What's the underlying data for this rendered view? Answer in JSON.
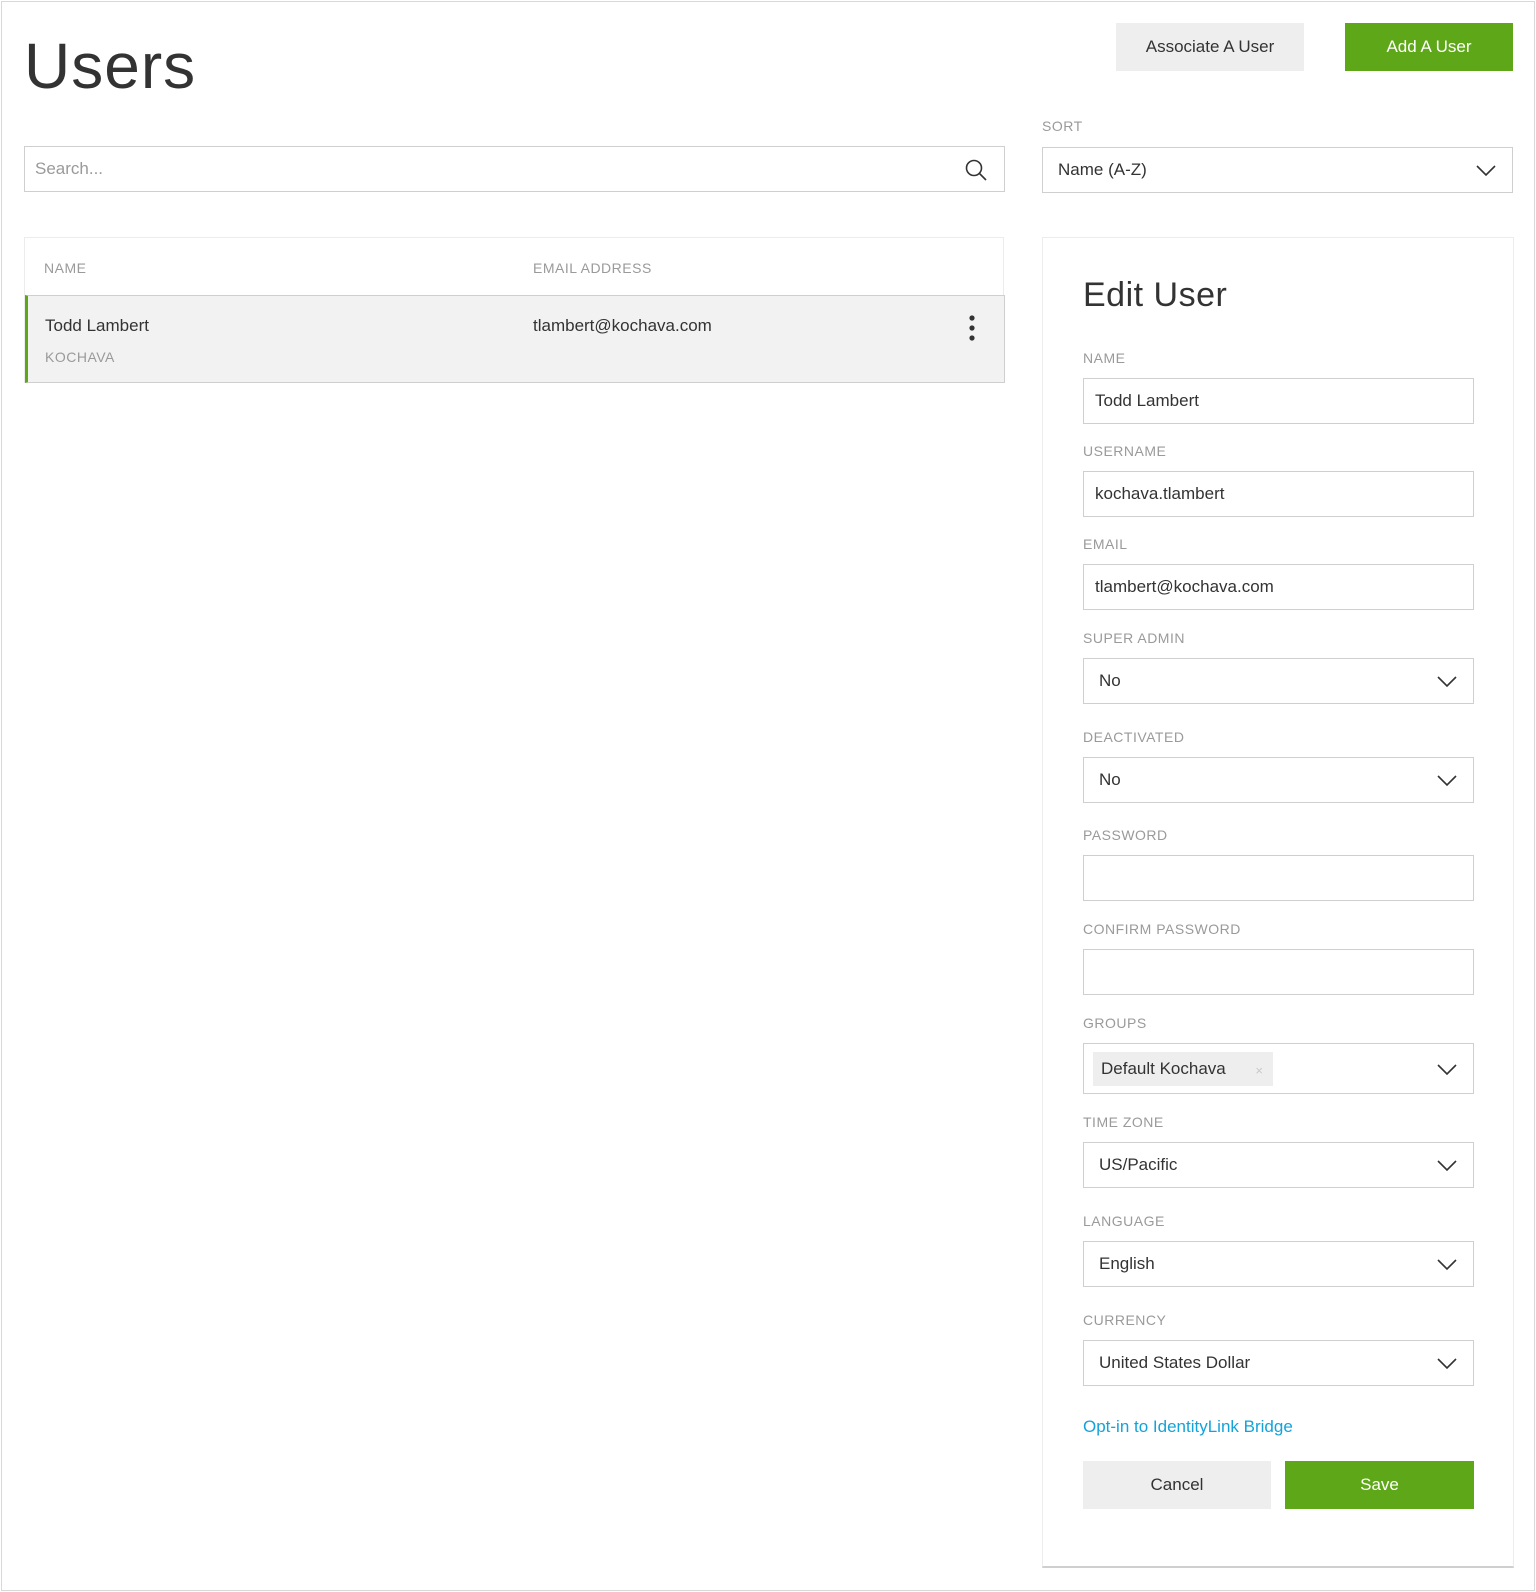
{
  "page": {
    "title": "Users"
  },
  "header": {
    "associate_label": "Associate A User",
    "add_label": "Add A User"
  },
  "search": {
    "placeholder": "Search..."
  },
  "sort": {
    "label": "SORT",
    "value": "Name (A-Z)"
  },
  "table": {
    "columns": [
      "NAME",
      "EMAIL ADDRESS"
    ],
    "rows": [
      {
        "name": "Todd Lambert",
        "org": "KOCHAVA",
        "email": "tlambert@kochava.com"
      }
    ]
  },
  "edit": {
    "title": "Edit User",
    "name": {
      "label": "NAME",
      "value": "Todd Lambert"
    },
    "username": {
      "label": "USERNAME",
      "value": "kochava.tlambert"
    },
    "email": {
      "label": "EMAIL",
      "value": "tlambert@kochava.com"
    },
    "super_admin": {
      "label": "SUPER ADMIN",
      "value": "No"
    },
    "deactivated": {
      "label": "DEACTIVATED",
      "value": "No"
    },
    "password": {
      "label": "PASSWORD",
      "value": ""
    },
    "confirm_password": {
      "label": "CONFIRM PASSWORD",
      "value": ""
    },
    "groups": {
      "label": "GROUPS",
      "tags": [
        "Default Kochava"
      ],
      "remove_glyph": "×"
    },
    "time_zone": {
      "label": "TIME ZONE",
      "value": "US/Pacific"
    },
    "language": {
      "label": "LANGUAGE",
      "value": "English"
    },
    "currency": {
      "label": "CURRENCY",
      "value": "United States Dollar"
    },
    "optin_link": "Opt-in to IdentityLink Bridge",
    "cancel_label": "Cancel",
    "save_label": "Save"
  },
  "colors": {
    "accent": "#5ea719",
    "link": "#14a3d9",
    "muted": "#9a9a9a",
    "border": "#cfcfcf"
  }
}
